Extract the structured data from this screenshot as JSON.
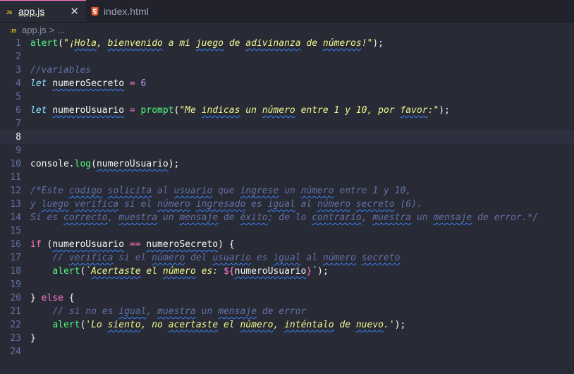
{
  "tabs": [
    {
      "icon": "js-file-icon",
      "icon_text": "JS",
      "label": "app.js",
      "active": true,
      "close": "✕"
    },
    {
      "icon": "html5-file-icon",
      "label": "index.html",
      "active": false
    }
  ],
  "breadcrumb": {
    "file": "app.js",
    "separator": ">",
    "more": "..."
  },
  "editor": {
    "current_line": 8,
    "lines": [
      {
        "n": "1",
        "tokens": [
          [
            "fn",
            "alert"
          ],
          [
            "txt",
            "("
          ],
          [
            "str",
            "\"¡Hola, bienvenido a mi juego de adivinanza de números!\""
          ],
          [
            "txt",
            ");"
          ]
        ]
      },
      {
        "n": "2",
        "tokens": []
      },
      {
        "n": "3",
        "tokens": [
          [
            "cm",
            "//variables"
          ]
        ]
      },
      {
        "n": "4",
        "tokens": [
          [
            "kw",
            "let"
          ],
          [
            "txt",
            " numeroSecreto "
          ],
          [
            "op",
            "="
          ],
          [
            "txt",
            " "
          ],
          [
            "num",
            "6"
          ]
        ]
      },
      {
        "n": "5",
        "tokens": []
      },
      {
        "n": "6",
        "tokens": [
          [
            "kw",
            "let"
          ],
          [
            "txt",
            " numeroUsuario "
          ],
          [
            "op",
            "="
          ],
          [
            "txt",
            " "
          ],
          [
            "fn",
            "prompt"
          ],
          [
            "txt",
            "("
          ],
          [
            "str",
            "\"Me indicas un número entre 1 y 10, por favor:\""
          ],
          [
            "txt",
            ");"
          ]
        ]
      },
      {
        "n": "7",
        "tokens": []
      },
      {
        "n": "8",
        "tokens": []
      },
      {
        "n": "9",
        "tokens": []
      },
      {
        "n": "10",
        "tokens": [
          [
            "txt",
            "console."
          ],
          [
            "fn",
            "log"
          ],
          [
            "txt",
            "(numeroUsuario);"
          ]
        ]
      },
      {
        "n": "11",
        "tokens": []
      },
      {
        "n": "12",
        "tokens": [
          [
            "cm",
            "/*Este codigo solicita al usuario que ingrese un número entre 1 y 10,"
          ]
        ]
      },
      {
        "n": "13",
        "tokens": [
          [
            "cm",
            "y luego verifica si el número ingresado es igual al número secreto (6)."
          ]
        ]
      },
      {
        "n": "14",
        "tokens": [
          [
            "cm",
            "Si es correcto, muestra un mensaje de éxito; de lo contrario, muestra un mensaje de error.*/"
          ]
        ]
      },
      {
        "n": "15",
        "tokens": []
      },
      {
        "n": "16",
        "tokens": [
          [
            "ctrl",
            "if"
          ],
          [
            "txt",
            " (numeroUsuario "
          ],
          [
            "op",
            "=="
          ],
          [
            "txt",
            " numeroSecreto) {"
          ]
        ]
      },
      {
        "n": "17",
        "tokens": [
          [
            "txt",
            "    "
          ],
          [
            "cm",
            "// verifica si el número del usuario es igual al número secreto"
          ]
        ]
      },
      {
        "n": "18",
        "tokens": [
          [
            "txt",
            "    "
          ],
          [
            "fn",
            "alert"
          ],
          [
            "txt",
            "("
          ],
          [
            "str",
            "`Acertaste el número es: "
          ],
          [
            "op",
            "${"
          ],
          [
            "txt",
            "numeroUsuario"
          ],
          [
            "op",
            "}"
          ],
          [
            "str",
            "`"
          ],
          [
            "txt",
            ");"
          ]
        ]
      },
      {
        "n": "19",
        "tokens": []
      },
      {
        "n": "20",
        "tokens": [
          [
            "txt",
            "} "
          ],
          [
            "ctrl",
            "else"
          ],
          [
            "txt",
            " {"
          ]
        ]
      },
      {
        "n": "21",
        "tokens": [
          [
            "txt",
            "    "
          ],
          [
            "cm",
            "// si no es igual, muestra un mensaje de error"
          ]
        ]
      },
      {
        "n": "22",
        "tokens": [
          [
            "txt",
            "    "
          ],
          [
            "fn",
            "alert"
          ],
          [
            "txt",
            "("
          ],
          [
            "str",
            "'Lo siento, no acertaste el número, inténtalo de nuevo.'"
          ],
          [
            "txt",
            ");"
          ]
        ]
      },
      {
        "n": "23",
        "tokens": [
          [
            "txt",
            "}"
          ]
        ]
      },
      {
        "n": "24",
        "tokens": []
      }
    ]
  }
}
